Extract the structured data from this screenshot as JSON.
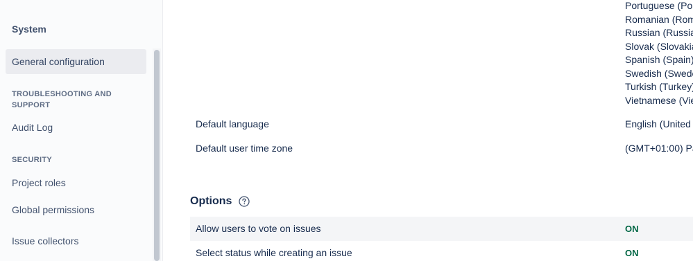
{
  "sidebar": {
    "title": "System",
    "items": {
      "general": "General configuration",
      "audit_log": "Audit Log",
      "project_roles": "Project roles",
      "global_permissions": "Global permissions",
      "issue_collectors": "Issue collectors"
    },
    "sections": {
      "troubleshooting": "TROUBLESHOOTING AND SUPPORT",
      "security": "SECURITY"
    }
  },
  "languages": [
    "Portuguese (Po",
    "Romanian (Rom",
    "Russian (Russia",
    "Slovak (Slovakia",
    "Spanish (Spain)",
    "Swedish (Swede",
    "Turkish (Turkey)",
    "Vietnamese (Vie"
  ],
  "settings": {
    "default_language": {
      "label": "Default language",
      "value": "English (United"
    },
    "default_time_zone": {
      "label": "Default user time zone",
      "value": "(GMT+01:00) Pa"
    }
  },
  "options": {
    "heading": "Options",
    "rows": [
      {
        "label": "Allow users to vote on issues",
        "status": "ON"
      },
      {
        "label": "Select status while creating an issue",
        "status": "ON"
      }
    ]
  },
  "colors": {
    "on_status": "#006644"
  }
}
